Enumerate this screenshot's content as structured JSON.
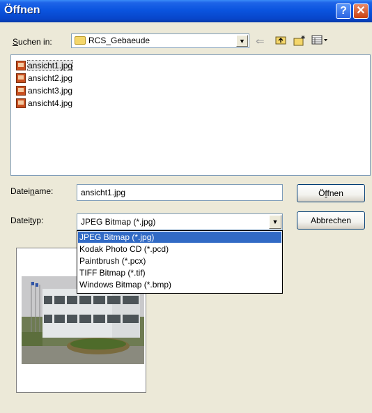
{
  "window": {
    "title": "Öffnen",
    "help_glyph": "?",
    "close_glyph": "✕"
  },
  "lookin": {
    "label_pre": "",
    "label_key": "S",
    "label_post": "uchen in:",
    "value": "RCS_Gebaeude",
    "nav_back_icon": "back-arrow-icon",
    "nav_up_icon": "up-folder-icon",
    "new_folder_icon": "new-folder-icon",
    "view_menu_icon": "view-menu-icon"
  },
  "files": [
    {
      "name": "ansicht1.jpg",
      "selected": true
    },
    {
      "name": "ansicht2.jpg",
      "selected": false
    },
    {
      "name": "ansicht3.jpg",
      "selected": false
    },
    {
      "name": "ansicht4.jpg",
      "selected": false
    }
  ],
  "filename": {
    "label_pre": "Datei",
    "label_key": "n",
    "label_post": "ame:",
    "value": "ansicht1.jpg"
  },
  "filetype": {
    "label_pre": "Datei",
    "label_key": "t",
    "label_post": "yp:",
    "value": "JPEG Bitmap (*.jpg)",
    "options": [
      "JPEG Bitmap (*.jpg)",
      "Kodak Photo CD (*.pcd)",
      "Paintbrush (*.pcx)",
      "TIFF Bitmap (*.tif)",
      "Windows Bitmap (*.bmp)"
    ],
    "highlighted_index": 0
  },
  "buttons": {
    "open_pre": "Ö",
    "open_key": "f",
    "open_post": "fnen",
    "cancel": "Abbrechen"
  },
  "colors": {
    "titlebar": "#0A54DF",
    "highlight": "#316AC5",
    "dialog_bg": "#ECE9D8"
  }
}
